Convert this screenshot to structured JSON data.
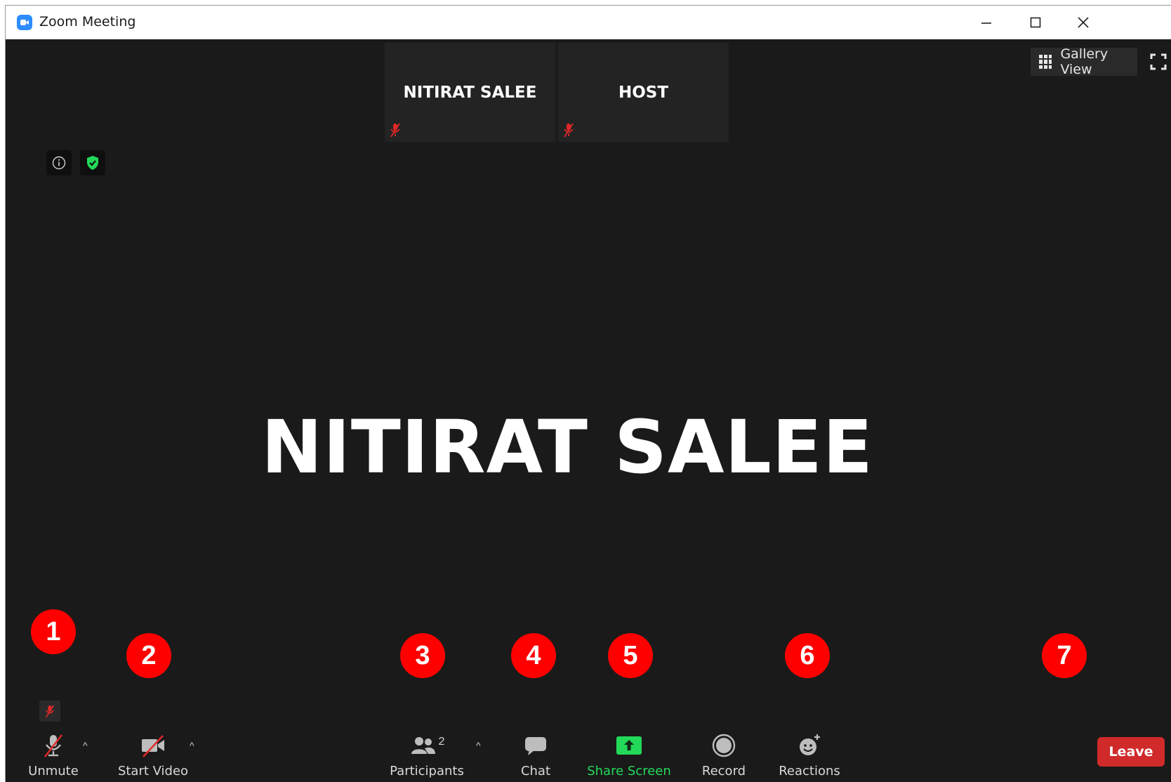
{
  "window": {
    "title": "Zoom Meeting",
    "controls": {
      "minimize_icon": "minimize-icon",
      "maximize_icon": "maximize-icon",
      "close_icon": "close-icon"
    }
  },
  "thumbnails": [
    {
      "name": "NITIRAT SALEE",
      "muted": true
    },
    {
      "name": "HOST",
      "muted": true
    }
  ],
  "view": {
    "gallery_label": "Gallery View"
  },
  "active_speaker": {
    "name": "NITIRAT SALEE"
  },
  "toolbar": {
    "unmute": "Unmute",
    "start_video": "Start Video",
    "participants": "Participants",
    "participants_count": "2",
    "chat": "Chat",
    "share_screen": "Share Screen",
    "record": "Record",
    "reactions": "Reactions",
    "leave": "Leave"
  },
  "badges": [
    "1",
    "2",
    "3",
    "4",
    "5",
    "6",
    "7"
  ],
  "colors": {
    "background": "#1a1a1a",
    "share_green": "#23d959",
    "leave_red": "#d02a2a",
    "badge_red": "#ff0000",
    "muted_red": "#e02828"
  }
}
